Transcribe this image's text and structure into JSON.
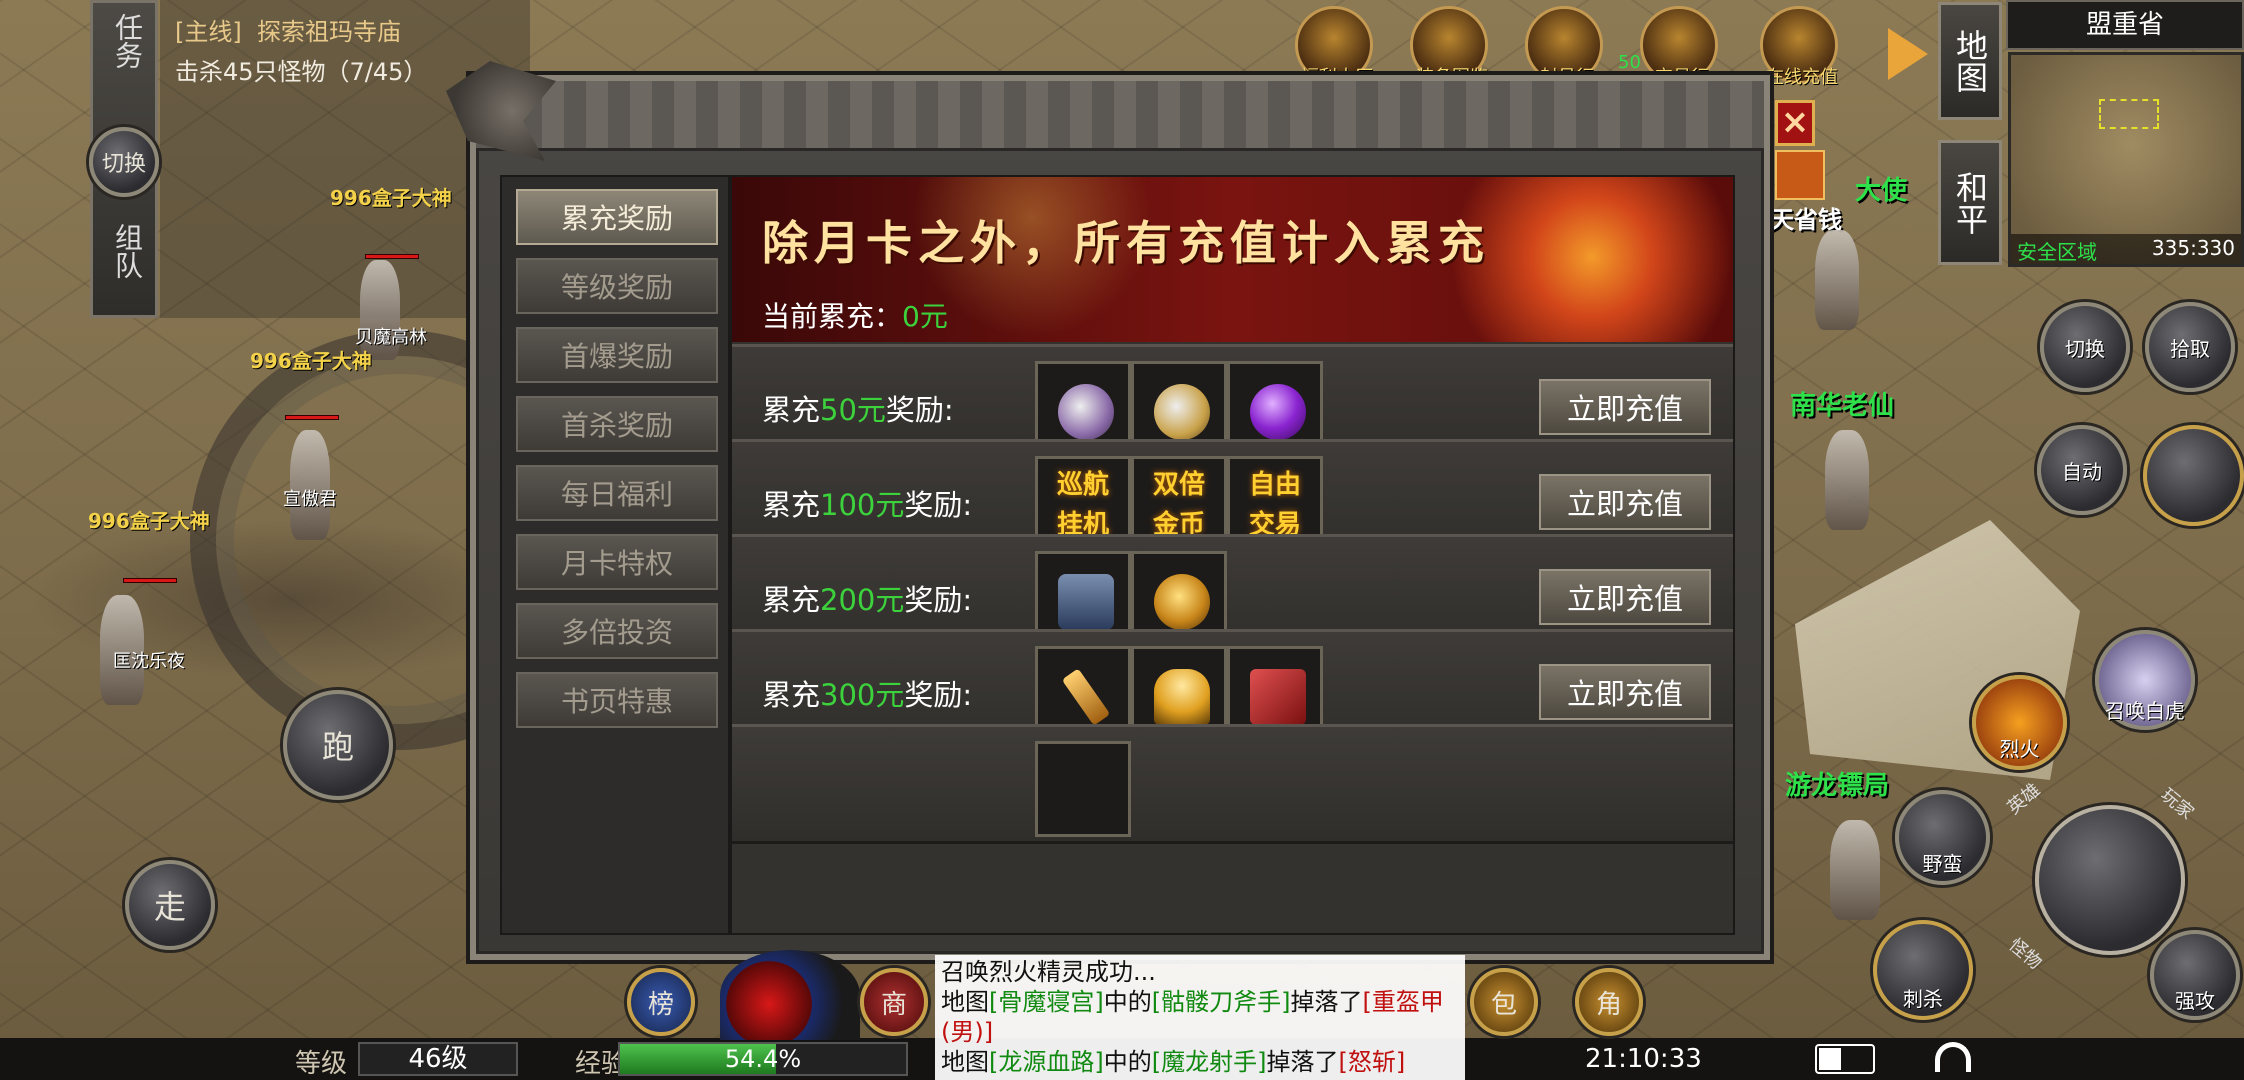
{
  "quest": {
    "side_label_task": "任务",
    "switch": "切换",
    "side_label_team": "组队",
    "tag": "[主线]",
    "title": "探索祖玛寺庙",
    "objective": "击杀45只怪物（7/45）"
  },
  "players": [
    {
      "title": "996盒子大神",
      "name": "贝魔高林"
    },
    {
      "title": "996盒子大神",
      "name": "宣傲君"
    },
    {
      "title": "996盒子大神",
      "name": "匡沈乐夜"
    },
    {
      "title": "996盒子大神",
      "name": ""
    }
  ],
  "npcs": [
    "南华老仙",
    "游龙镖局",
    "大使",
    "天省钱"
  ],
  "top_icons": [
    {
      "label": "福利大厅",
      "icon": "welfare-icon"
    },
    {
      "label": "装备图鉴",
      "icon": "armor-icon"
    },
    {
      "label": "封号行",
      "icon": "helmet-icon"
    },
    {
      "label": "交易行",
      "icon": "trade-icon"
    },
    {
      "label": "在线充值",
      "icon": "gold-ingot-icon"
    }
  ],
  "top_icon_badge": "50",
  "map": {
    "region": "盟重省",
    "map_tab": "地图",
    "peace_tab": "和平",
    "safe_zone": "安全区域",
    "coords": "335:330"
  },
  "panel": {
    "close": "×",
    "tabs": [
      "累充奖励",
      "等级奖励",
      "首爆奖励",
      "首杀奖励",
      "每日福利",
      "月卡特权",
      "多倍投资",
      "书页特惠"
    ],
    "active_tab": 0,
    "banner_title": "除月卡之外，所有充值计入累充",
    "current_label": "当前累充：",
    "current_value": "0元",
    "rows": [
      {
        "prefix": "累充",
        "amount": "50元",
        "suffix": "奖励:",
        "button": "立即充值",
        "items": [
          {
            "kind": "gem",
            "name": "purple-scroll-icon"
          },
          {
            "kind": "gem",
            "name": "gold-scroll-icon"
          },
          {
            "kind": "gem",
            "name": "purple-orb-icon"
          }
        ]
      },
      {
        "prefix": "累充",
        "amount": "100元",
        "suffix": "奖励:",
        "button": "立即充值",
        "items": [
          {
            "kind": "text",
            "text": "巡航挂机"
          },
          {
            "kind": "text",
            "text": "双倍金币"
          },
          {
            "kind": "text",
            "text": "自由交易"
          }
        ]
      },
      {
        "prefix": "累充",
        "amount": "200元",
        "suffix": "奖励:",
        "button": "立即充值",
        "items": [
          {
            "kind": "gem",
            "name": "treasure-chest-icon"
          },
          {
            "kind": "gem",
            "name": "gold-bracelet-icon"
          }
        ]
      },
      {
        "prefix": "累充",
        "amount": "300元",
        "suffix": "奖励:",
        "button": "立即充值",
        "items": [
          {
            "kind": "gem",
            "name": "gold-blade-icon"
          },
          {
            "kind": "gem",
            "name": "golden-body-icon"
          },
          {
            "kind": "gem",
            "name": "red-book-icon"
          }
        ]
      }
    ]
  },
  "right_buttons": {
    "switch": "切换",
    "pickup": "拾取",
    "auto": "自动",
    "summon": "召唤白虎",
    "fire": "烈火",
    "wild": "野蛮",
    "kill": "刺杀",
    "attack": "强攻",
    "arc1": "英雄",
    "arc2": "玩家",
    "arc3": "怪物"
  },
  "left_buttons": {
    "run": "跑",
    "walk": "走"
  },
  "bottom": {
    "rank": "榜",
    "shop": "商",
    "bag": "包",
    "role": "角",
    "level_label": "等级",
    "level_value": "46级",
    "exp_label": "经验",
    "exp_value": "54.4%",
    "exp_fraction": 0.544,
    "time": "21:10:33"
  },
  "chat": {
    "line1": "召唤烈火精灵成功...",
    "l2_a": "地图",
    "l2_map": "[骨魔寝宫]",
    "l2_b": "中的",
    "l2_mon": "[骷髅刀斧手]",
    "l2_c": "掉落了",
    "l2_item": "[重盔甲(男)]",
    "l3_a": "地图",
    "l3_map": "[龙源血路]",
    "l3_b": "中的",
    "l3_mon": "[魔龙射手]",
    "l3_c": "掉落了",
    "l3_item": "[怒斩]"
  },
  "colors": {
    "accent_green": "#3cd23c",
    "npc_green": "#2ee04a",
    "title_gold": "#f3d24a",
    "close_red": "#a31212"
  }
}
